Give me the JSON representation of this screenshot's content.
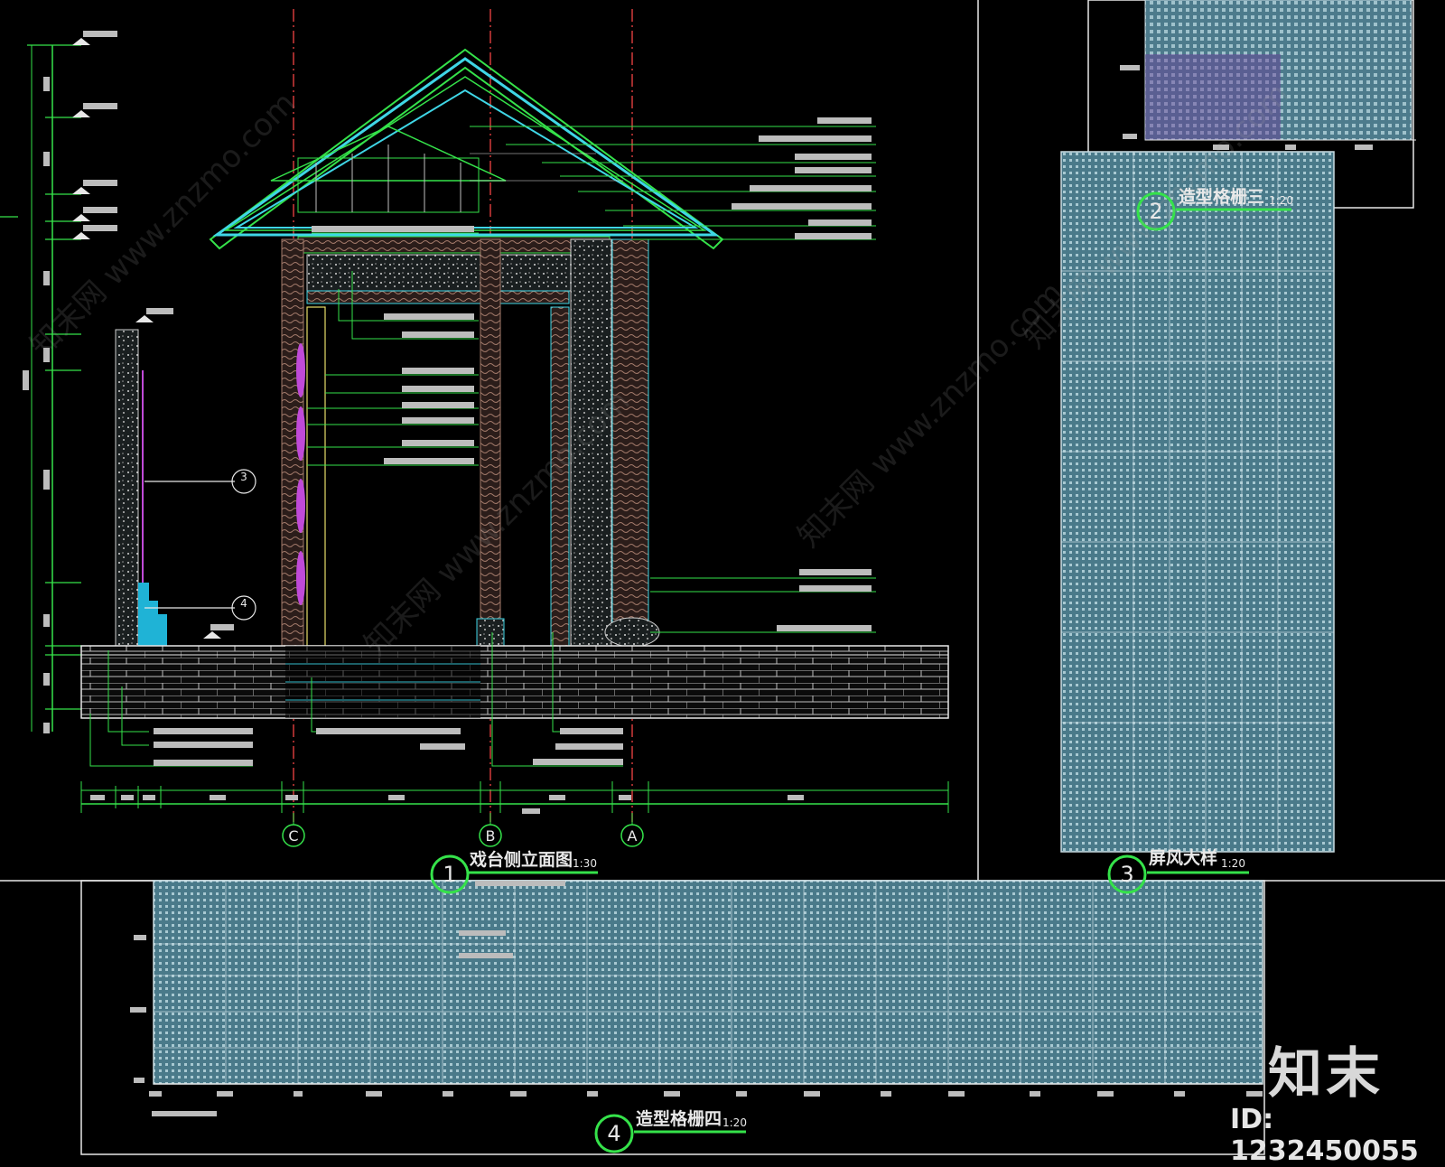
{
  "drawings": [
    {
      "number": "1",
      "title": "戏台侧立面图",
      "scale": "1:30"
    },
    {
      "number": "2",
      "title": "造型格栅三",
      "scale": "1:20"
    },
    {
      "number": "3",
      "title": "屏风大样",
      "scale": "1:20"
    },
    {
      "number": "4",
      "title": "造型格栅四",
      "scale": "1:20"
    }
  ],
  "axes": [
    "C",
    "B",
    "A"
  ],
  "watermark": {
    "brand": "知末",
    "id": "ID: 1232450055",
    "site": "知末网 www.znzmo.com"
  },
  "colors": {
    "background": "#000000",
    "green": "#35e24a",
    "cyan": "#3fd6e6",
    "yellow": "#e8e06a",
    "grid_fill": "#5a8a9c",
    "grid_line": "#c9dde3",
    "red_axis": "#d23a3a",
    "magenta": "#c04ad8",
    "white": "#e8e8e8"
  }
}
